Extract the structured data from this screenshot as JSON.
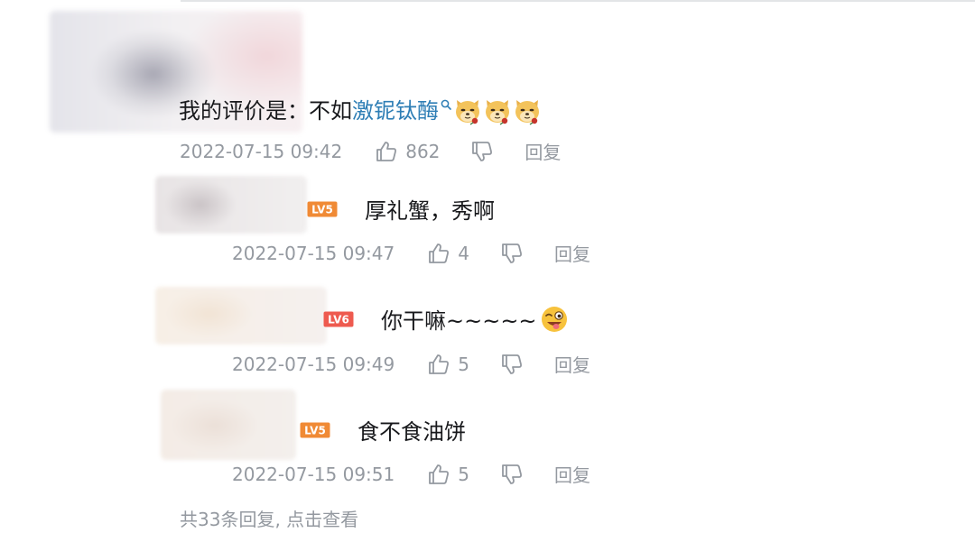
{
  "main_comment": {
    "text_prefix": "我的评价是：不如",
    "search_link": "激铌钛酶",
    "time": "2022-07-15 09:42",
    "likes": "862",
    "reply_label": "回复"
  },
  "replies": [
    {
      "level": "LV5",
      "text": "厚礼蟹，秀啊",
      "time": "2022-07-15 09:47",
      "likes": "4",
      "reply_label": "回复"
    },
    {
      "level": "LV6",
      "text": "你干嘛~~~~~",
      "time": "2022-07-15 09:49",
      "likes": "5",
      "reply_label": "回复"
    },
    {
      "level": "LV5",
      "text": "食不食油饼",
      "time": "2022-07-15 09:51",
      "likes": "5",
      "reply_label": "回复"
    }
  ],
  "view_more": "共33条回复, 点击查看",
  "colors": {
    "link": "#2e7eb5",
    "meta_gray": "#9499a0",
    "lv5_badge": "#f08a35",
    "lv6_badge": "#ee5a4f"
  },
  "icons": {
    "like": "thumbs-up-icon",
    "dislike": "thumbs-down-icon",
    "search_sup": "search-icon",
    "emote_doge": "doge-emote-icon",
    "emote_wink": "wink-emoji-icon"
  }
}
